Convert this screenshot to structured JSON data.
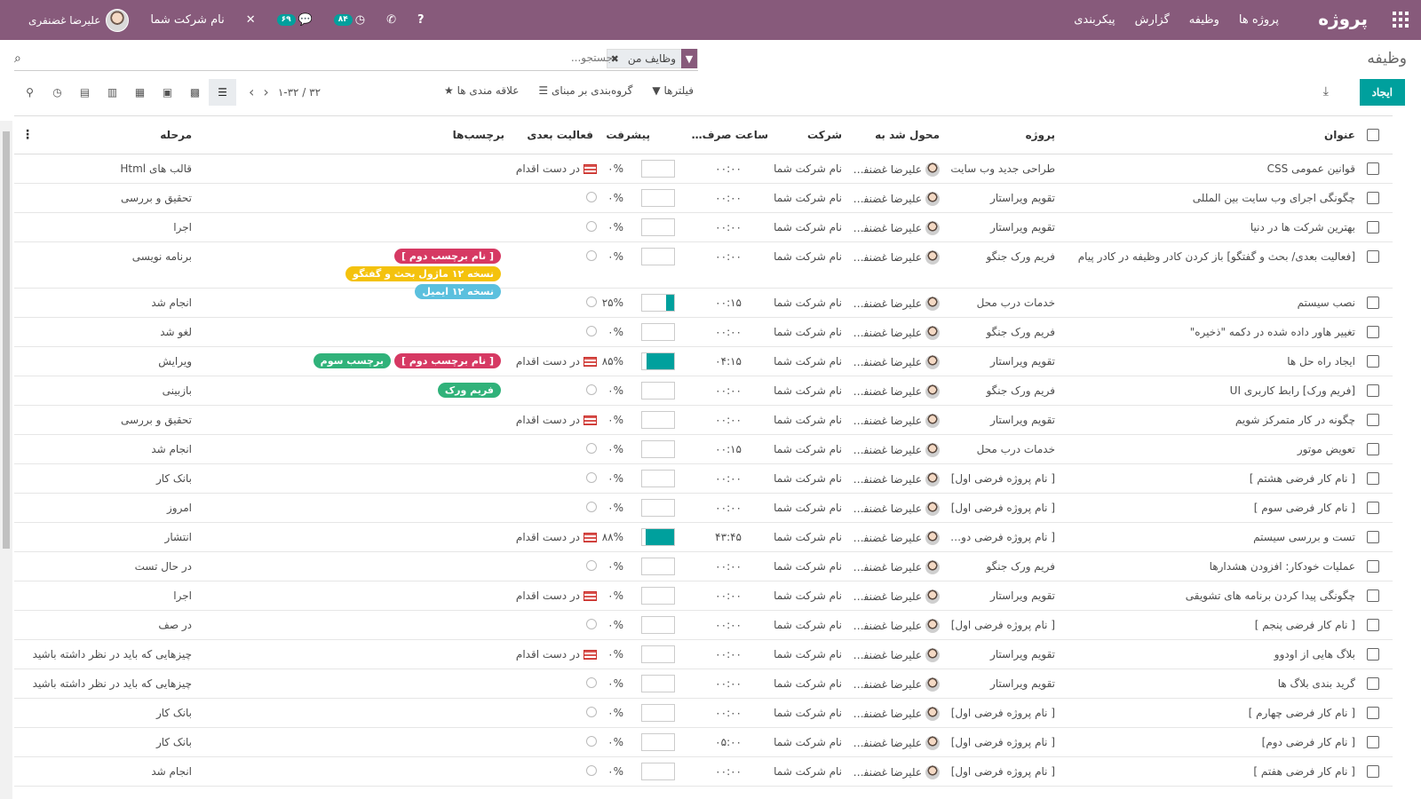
{
  "navbar": {
    "brand": "پروژه",
    "menu": [
      "پروژه ها",
      "وظیفه",
      "گزارش",
      "پیکربندی"
    ],
    "company": "نام شرکت شما",
    "user": "علیرضا غضنفری",
    "activity_badge": "۸۴",
    "messages_badge": "۶۹"
  },
  "control": {
    "title": "وظیفه",
    "facet": "وظایف من",
    "search_placeholder": "جستجو...",
    "create_label": "ایجاد",
    "filters_label": "فیلترها",
    "groupby_label": "گروه‌بندی بر مبنای",
    "favorites_label": "علاقه مندی ها",
    "pager": "۱-۳۲ / ۳۲"
  },
  "columns": {
    "name": "عنوان",
    "project": "پروژه",
    "assigned": "محول شد به",
    "company": "شرکت",
    "hours": "ساعت صرف شده",
    "progress": "پیشرفت",
    "activity": "فعالیت بعدی",
    "tags": "برچسب‌ها",
    "stage": "مرحله"
  },
  "colors": {
    "primary": "#875a7b",
    "accent": "#00a09d",
    "tag_red": "#d63963",
    "tag_green": "#30b27a",
    "tag_yellow": "#f4c20d",
    "tag_blue": "#5bc0de"
  },
  "rows": [
    {
      "name": "قوانین عمومی CSS",
      "project": "طراحی جدید وب سایت",
      "assigned": "علیرضا غضنفری",
      "company": "نام شرکت شما",
      "hours": "۰۰:۰۰",
      "progress": 0,
      "pct": "۰%",
      "activity": "در دست اقدام",
      "stage": "قالب های Html",
      "tags": []
    },
    {
      "name": "چگونگی اجرای وب سایت بین المللی",
      "project": "تقویم ویراستار",
      "assigned": "علیرضا غضنفری",
      "company": "نام شرکت شما",
      "hours": "۰۰:۰۰",
      "progress": 0,
      "pct": "۰%",
      "activity": "",
      "stage": "تحقیق و بررسی",
      "tags": []
    },
    {
      "name": "بهترین شرکت ها در دنیا",
      "project": "تقویم ویراستار",
      "assigned": "علیرضا غضنفری",
      "company": "نام شرکت شما",
      "hours": "۰۰:۰۰",
      "progress": 0,
      "pct": "۰%",
      "activity": "",
      "stage": "اجرا",
      "tags": []
    },
    {
      "name": "[فعالیت بعدی/ بحث و گفتگو] باز کردن کادر وظیفه در کادر پیام",
      "project": "فریم ورک جنگو",
      "assigned": "علیرضا غضنفری",
      "company": "نام شرکت شما",
      "hours": "۰۰:۰۰",
      "progress": 0,
      "pct": "۰%",
      "activity": "",
      "stage": "برنامه نویسی",
      "tall": true,
      "tags": [
        {
          "label": "[ نام برچسب دوم ]",
          "color": "red"
        },
        {
          "label": "نسخه ۱۲ ماژول بحث و گفتگو",
          "color": "yellow"
        },
        {
          "label": "نسخه ۱۲ ایمیل",
          "color": "blue"
        }
      ]
    },
    {
      "name": "نصب سیستم",
      "project": "خدمات درب محل",
      "assigned": "علیرضا غضنفری",
      "company": "نام شرکت شما",
      "hours": "۰۰:۱۵",
      "progress": 25,
      "pct": "۲۵%",
      "activity": "",
      "stage": "انجام شد",
      "tags": []
    },
    {
      "name": "تغییر هاور داده شده در دکمه \"ذخیره\"",
      "project": "فریم ورک جنگو",
      "assigned": "علیرضا غضنفری",
      "company": "نام شرکت شما",
      "hours": "۰۰:۰۰",
      "progress": 0,
      "pct": "۰%",
      "activity": "",
      "stage": "لغو شد",
      "tags": []
    },
    {
      "name": "ایجاد راه حل ها",
      "project": "تقویم ویراستار",
      "assigned": "علیرضا غضنفری",
      "company": "نام شرکت شما",
      "hours": "۰۴:۱۵",
      "progress": 85,
      "pct": "۸۵%",
      "activity": "در دست اقدام",
      "stage": "ویرایش",
      "tags": [
        {
          "label": "[ نام برچسب دوم ]",
          "color": "red"
        },
        {
          "label": "برچسب سوم",
          "color": "green"
        }
      ]
    },
    {
      "name": "[فریم ورک] رابط کاربری UI",
      "project": "فریم ورک جنگو",
      "assigned": "علیرضا غضنفری",
      "company": "نام شرکت شما",
      "hours": "۰۰:۰۰",
      "progress": 0,
      "pct": "۰%",
      "activity": "",
      "stage": "بازبینی",
      "tags": [
        {
          "label": "فریم ورک",
          "color": "green"
        }
      ]
    },
    {
      "name": "چگونه در کار متمرکز شویم",
      "project": "تقویم ویراستار",
      "assigned": "علیرضا غضنفری",
      "company": "نام شرکت شما",
      "hours": "۰۰:۰۰",
      "progress": 0,
      "pct": "۰%",
      "activity": "در دست اقدام",
      "stage": "تحقیق و بررسی",
      "tags": []
    },
    {
      "name": "تعویض موتور",
      "project": "خدمات درب محل",
      "assigned": "علیرضا غضنفری",
      "company": "نام شرکت شما",
      "hours": "۰۰:۱۵",
      "progress": 0,
      "pct": "۰%",
      "activity": "",
      "stage": "انجام شد",
      "tags": []
    },
    {
      "name": "[ نام کار فرضی هشتم ]",
      "project": "[ نام پروژه فرضی اول]",
      "assigned": "علیرضا غضنفری",
      "company": "نام شرکت شما",
      "hours": "۰۰:۰۰",
      "progress": 0,
      "pct": "۰%",
      "activity": "",
      "stage": "بانک کار",
      "tags": []
    },
    {
      "name": "[ نام کار فرضی سوم ]",
      "project": "[ نام پروژه فرضی اول]",
      "assigned": "علیرضا غضنفری",
      "company": "نام شرکت شما",
      "hours": "۰۰:۰۰",
      "progress": 0,
      "pct": "۰%",
      "activity": "",
      "stage": "امروز",
      "tags": []
    },
    {
      "name": "تست و بررسی سیستم",
      "project": "[ نام پروژه فرضی دوم ]",
      "assigned": "علیرضا غضنفری",
      "company": "نام شرکت شما",
      "hours": "۴۳:۴۵",
      "progress": 88,
      "pct": "۸۸%",
      "activity": "در دست اقدام",
      "stage": "انتشار",
      "tags": []
    },
    {
      "name": "عملیات خودکار: افزودن هشدارها",
      "project": "فریم ورک جنگو",
      "assigned": "علیرضا غضنفری",
      "company": "نام شرکت شما",
      "hours": "۰۰:۰۰",
      "progress": 0,
      "pct": "۰%",
      "activity": "",
      "stage": "در حال تست",
      "tags": []
    },
    {
      "name": "چگونگی پیدا کردن برنامه های تشویقی",
      "project": "تقویم ویراستار",
      "assigned": "علیرضا غضنفری",
      "company": "نام شرکت شما",
      "hours": "۰۰:۰۰",
      "progress": 0,
      "pct": "۰%",
      "activity": "در دست اقدام",
      "stage": "اجرا",
      "tags": []
    },
    {
      "name": "[ نام کار فرضی پنجم ]",
      "project": "[ نام پروژه فرضی اول]",
      "assigned": "علیرضا غضنفری",
      "company": "نام شرکت شما",
      "hours": "۰۰:۰۰",
      "progress": 0,
      "pct": "۰%",
      "activity": "",
      "stage": "در صف",
      "tags": []
    },
    {
      "name": "بلاگ هایی از اودوو",
      "project": "تقویم ویراستار",
      "assigned": "علیرضا غضنفری",
      "company": "نام شرکت شما",
      "hours": "۰۰:۰۰",
      "progress": 0,
      "pct": "۰%",
      "activity": "در دست اقدام",
      "stage": "چیزهایی که باید در نظر داشته باشید",
      "tags": []
    },
    {
      "name": "گرید بندی بلاگ ها",
      "project": "تقویم ویراستار",
      "assigned": "علیرضا غضنفری",
      "company": "نام شرکت شما",
      "hours": "۰۰:۰۰",
      "progress": 0,
      "pct": "۰%",
      "activity": "",
      "stage": "چیزهایی که باید در نظر داشته باشید",
      "tags": []
    },
    {
      "name": "[ نام کار فرضی چهارم ]",
      "project": "[ نام پروژه فرضی اول]",
      "assigned": "علیرضا غضنفری",
      "company": "نام شرکت شما",
      "hours": "۰۰:۰۰",
      "progress": 0,
      "pct": "۰%",
      "activity": "",
      "stage": "بانک کار",
      "tags": []
    },
    {
      "name": "[ نام کار فرضی دوم]",
      "project": "[ نام پروژه فرضی اول]",
      "assigned": "علیرضا غضنفری",
      "company": "نام شرکت شما",
      "hours": "۰۵:۰۰",
      "progress": 0,
      "pct": "۰%",
      "activity": "",
      "stage": "بانک کار",
      "tags": []
    },
    {
      "name": "[ نام کار فرضی هفتم ]",
      "project": "[ نام پروژه فرضی اول]",
      "assigned": "علیرضا غضنفری",
      "company": "نام شرکت شما",
      "hours": "۰۰:۰۰",
      "progress": 0,
      "pct": "۰%",
      "activity": "",
      "stage": "انجام شد",
      "tags": []
    }
  ]
}
